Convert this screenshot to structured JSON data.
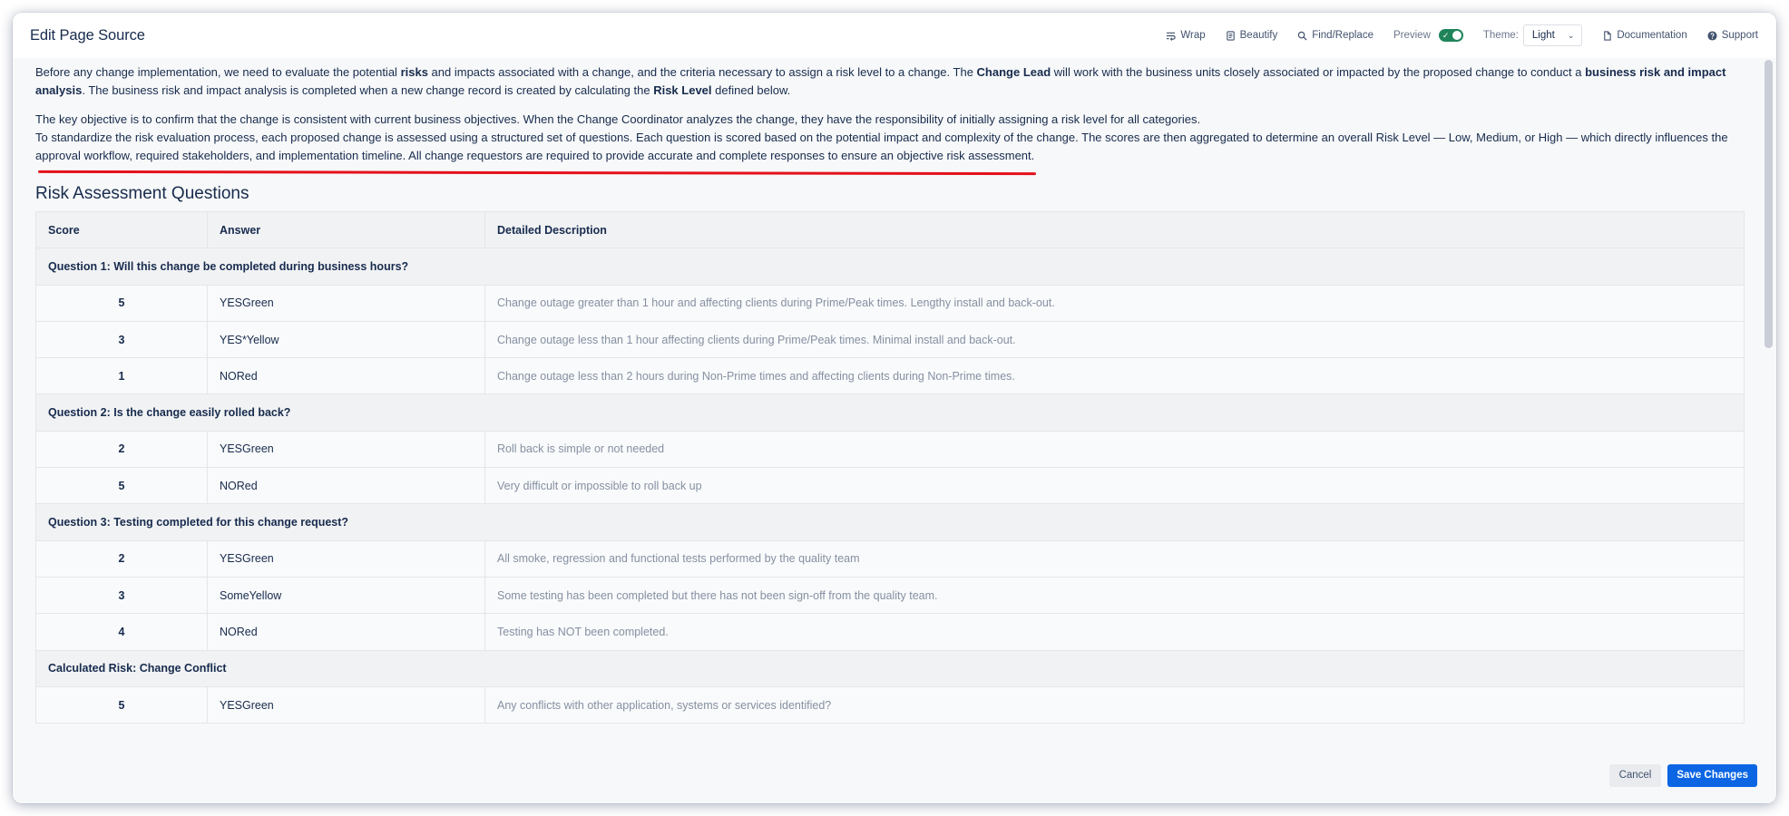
{
  "header": {
    "title": "Edit Page Source",
    "toolbar": {
      "wrap_label": "Wrap",
      "beautify_label": "Beautify",
      "find_replace_label": "Find/Replace",
      "preview_label": "Preview",
      "preview_enabled": true,
      "theme_label": "Theme:",
      "theme_value": "Light",
      "documentation_label": "Documentation",
      "support_label": "Support"
    }
  },
  "intro": {
    "p1_a": "Before any change implementation, we need to evaluate the potential ",
    "p1_b": "risks",
    "p1_c": " and impacts associated with a change, and the criteria necessary to assign a risk level to a change. The ",
    "p1_d": "Change Lead",
    "p1_e": " will work with the business units closely associated or impacted by the proposed change to conduct a ",
    "p1_f": "business risk and impact analysis",
    "p1_g": ". The business risk and impact analysis is completed when a new change record is created by calculating the ",
    "p1_h": "Risk Level",
    "p1_i": " defined below.",
    "p2": "The key objective is to confirm that the change is consistent with current business objectives. When the Change Coordinator analyzes the change, they have the responsibility of initially assigning a risk level for all categories.",
    "p3": "To standardize the risk evaluation process, each proposed change is assessed using a structured set of questions. Each question is scored based on the potential impact and complexity of the change. The scores are then aggregated to determine an overall Risk Level — Low, Medium, or High — which directly influences the approval workflow, required stakeholders, and implementation timeline. All change requestors are required to provide accurate and complete responses to ensure an objective risk assessment."
  },
  "section_title": "Risk Assessment Questions",
  "table": {
    "headers": [
      "Score",
      "Answer",
      "Detailed Description"
    ],
    "groups": [
      {
        "question": "Question 1: Will this change be completed during business hours?",
        "rows": [
          {
            "score": "5",
            "answer": "YESGreen",
            "description": "Change outage greater than 1 hour and affecting clients during Prime/Peak times. Lengthy install and back-out."
          },
          {
            "score": "3",
            "answer": "YES*Yellow",
            "description": "Change outage less than 1 hour affecting clients during Prime/Peak times. Minimal install and back-out."
          },
          {
            "score": "1",
            "answer": "NORed",
            "description": "Change outage less than 2 hours during Non-Prime times and affecting clients during Non-Prime times."
          }
        ]
      },
      {
        "question": "Question 2: Is the change easily rolled back?",
        "rows": [
          {
            "score": "2",
            "answer": "YESGreen",
            "description": "Roll back is simple or not needed"
          },
          {
            "score": "5",
            "answer": "NORed",
            "description": "Very difficult or impossible to roll back up"
          }
        ]
      },
      {
        "question": "Question 3: Testing completed for this change request?",
        "rows": [
          {
            "score": "2",
            "answer": "YESGreen",
            "description": "All smoke, regression and functional tests performed by the quality team"
          },
          {
            "score": "3",
            "answer": "SomeYellow",
            "description": "Some testing has been completed but there has not been sign-off from the quality team."
          },
          {
            "score": "4",
            "answer": "NORed",
            "description": " Testing has NOT been completed."
          }
        ]
      },
      {
        "question": "Calculated Risk: Change Conflict",
        "rows": [
          {
            "score": "5",
            "answer": "YESGreen",
            "description": "Any conflicts with other application, systems or services identified?"
          }
        ]
      }
    ]
  },
  "footer": {
    "cancel_label": "Cancel",
    "save_label": "Save Changes"
  },
  "colors": {
    "primary": "#0c66e4",
    "toggle_on": "#1f845a",
    "annotation_red": "#e5111b"
  }
}
